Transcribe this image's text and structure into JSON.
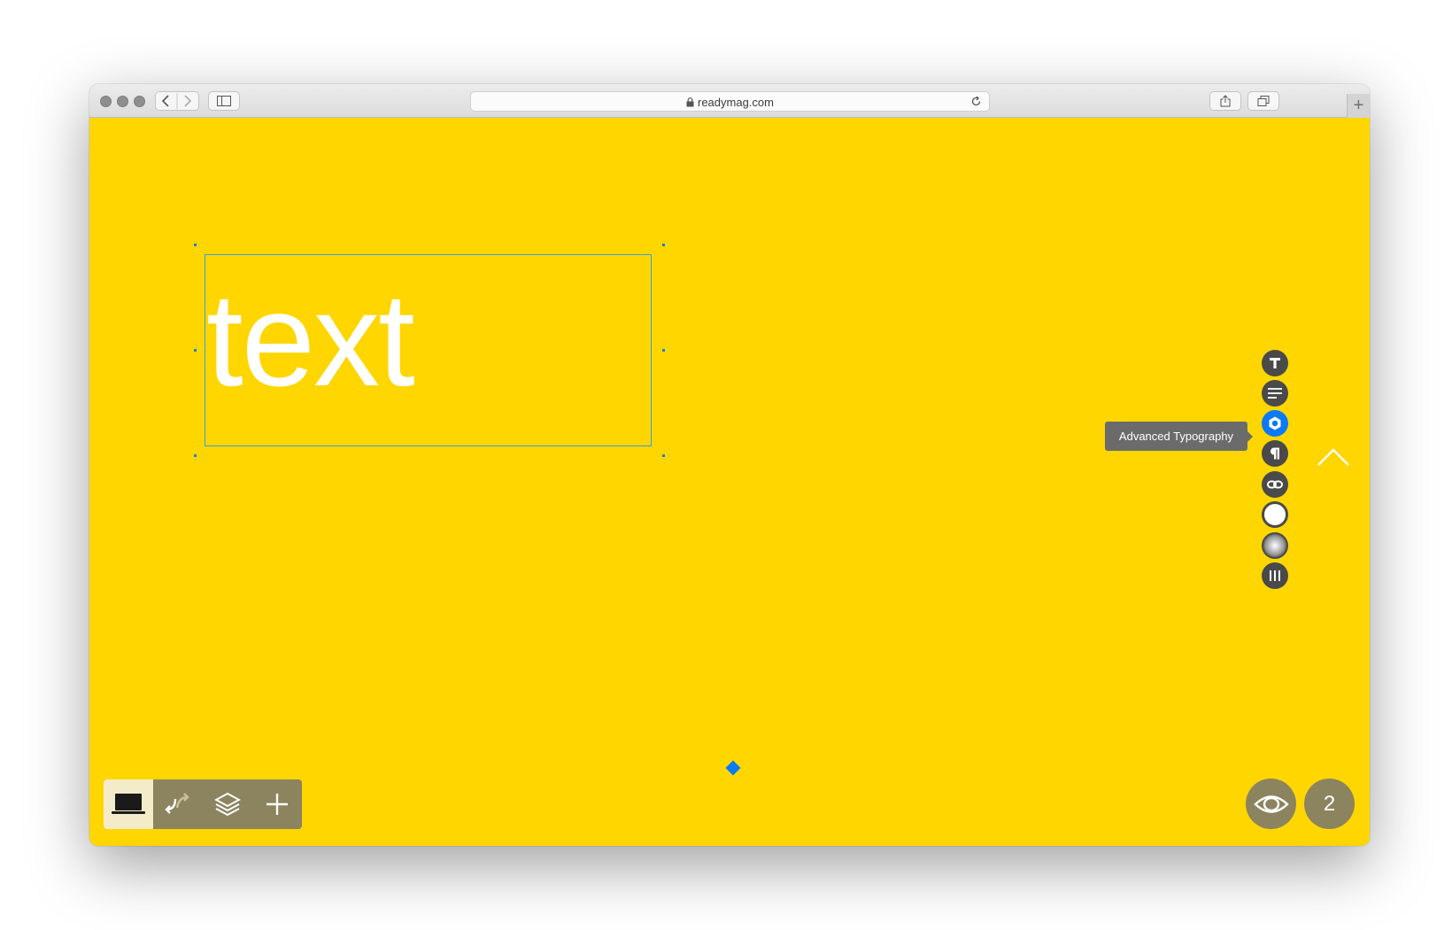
{
  "browser": {
    "url": "readymag.com",
    "new_tab_label": "+"
  },
  "canvas": {
    "background": "#ffd600",
    "text_widget": {
      "content": "text",
      "color": "#ffffff"
    }
  },
  "side_toolbar": {
    "tooltip": "Advanced Typography",
    "items": [
      {
        "icon": "text-font-icon"
      },
      {
        "icon": "text-align-icon"
      },
      {
        "icon": "advanced-typography-icon",
        "active": true
      },
      {
        "icon": "paragraph-icon"
      },
      {
        "icon": "link-icon"
      },
      {
        "icon": "color-fill-icon"
      },
      {
        "icon": "shadow-icon"
      },
      {
        "icon": "columns-icon"
      }
    ],
    "accent": "#0a7af5"
  },
  "bottom_toolbar": {
    "items": [
      {
        "icon": "laptop-icon",
        "selected": true
      },
      {
        "icon": "transition-arrows-icon"
      },
      {
        "icon": "layers-icon"
      },
      {
        "icon": "plus-icon"
      }
    ]
  },
  "preview": {
    "icon": "eye-icon"
  },
  "page_number": "2"
}
